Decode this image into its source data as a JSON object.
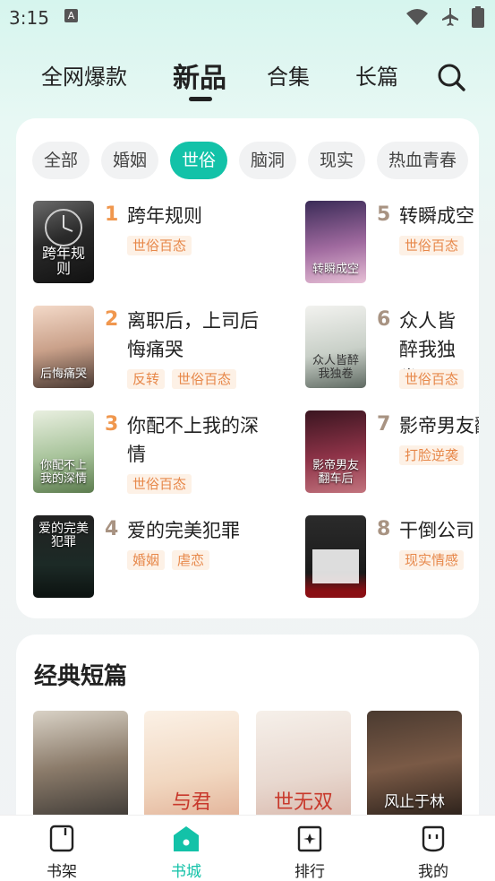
{
  "status": {
    "time": "3:15",
    "notification_letter": "A"
  },
  "top_tabs": [
    "全网爆款",
    "新品",
    "合集",
    "长篇"
  ],
  "active_top_tab": "新品",
  "chips": [
    "全部",
    "婚姻",
    "世俗",
    "脑洞",
    "现实",
    "热血青春"
  ],
  "active_chip": "世俗",
  "books": [
    {
      "rank": "1",
      "title": "跨年规则",
      "tags": [
        "世俗百态"
      ],
      "cover_text": "跨年规则",
      "rank_color": "#f0974e"
    },
    {
      "rank": "2",
      "title": "离职后，上司后悔痛哭",
      "tags": [
        "反转",
        "世俗百态"
      ],
      "cover_text": "后悔痛哭",
      "rank_color": "#f0974e"
    },
    {
      "rank": "3",
      "title": "你配不上我的深情",
      "tags": [
        "世俗百态"
      ],
      "cover_text": "你配不上我的深情",
      "rank_color": "#f0974e"
    },
    {
      "rank": "4",
      "title": "爱的完美犯罪",
      "tags": [
        "婚姻",
        "虐恋"
      ],
      "cover_text": "爱的完美犯罪",
      "rank_color": "#a89382"
    },
    {
      "rank": "5",
      "title": "转瞬成空",
      "tags": [
        "世俗百态"
      ],
      "cover_text": "转瞬成空",
      "rank_color": "#a89382"
    },
    {
      "rank": "6",
      "title": "众人皆醉我独卷",
      "tags": [
        "世俗百态"
      ],
      "cover_text": "众人皆醉我独卷",
      "rank_color": "#a89382"
    },
    {
      "rank": "7",
      "title": "影帝男友翻车后",
      "tags": [
        "打脸逆袭"
      ],
      "cover_text": "影帝男友翻车后",
      "rank_color": "#a89382"
    },
    {
      "rank": "8",
      "title": "干倒公司",
      "tags": [
        "现实情感"
      ],
      "cover_text": "",
      "rank_color": "#a89382"
    }
  ],
  "short_section": {
    "title": "经典短篇",
    "covers": [
      "",
      "与君",
      "世无双",
      "风止于林"
    ]
  },
  "bottom_nav": [
    "书架",
    "书城",
    "排行",
    "我的"
  ],
  "active_bottom": "书城",
  "colors": {
    "accent": "#13c2a8",
    "tag_text": "#e7884a",
    "tag_bg": "#fdf1e6"
  }
}
